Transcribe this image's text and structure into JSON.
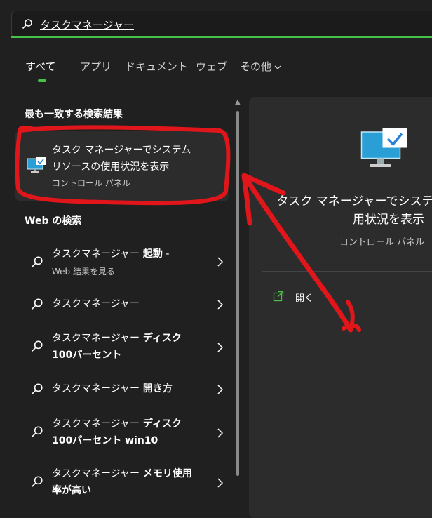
{
  "search": {
    "value": "タスクマネージャー"
  },
  "tabs": [
    {
      "label": "すべて",
      "active": true
    },
    {
      "label": "アプリ"
    },
    {
      "label": "ドキュメント"
    },
    {
      "label": "ウェブ"
    },
    {
      "label": "その他"
    }
  ],
  "best_match": {
    "section_title": "最も一致する検索結果",
    "title_line1": "タスク マネージャーでシステム",
    "title_line2": "リソースの使用状況を表示",
    "subtitle": "コントロール パネル"
  },
  "web": {
    "section_title": "Web の検索",
    "items": [
      {
        "text": "タスクマネージャー",
        "bold": " 起動",
        "suffix": " -",
        "sub": "Web 結果を見る"
      },
      {
        "text": "タスクマネージャー"
      },
      {
        "text": "タスクマネージャー",
        "bold": " ディスク",
        "line2": "100パーセント"
      },
      {
        "text": "タスクマネージャー",
        "bold": " 開き方"
      },
      {
        "text": "タスクマネージャー",
        "bold": " ディスク",
        "line2": "100パーセント win10"
      },
      {
        "text": "タスクマネージャー",
        "bold": " メモリ使用",
        "line2": "率が高い"
      }
    ]
  },
  "detail": {
    "title_line1": "タスク マネージャーでシステム",
    "title_line2": "用状況を表示",
    "subtitle": "コントロール パネル",
    "open_label": "開く"
  },
  "colors": {
    "accent": "#47c146",
    "annotation": "#e0161b",
    "background": "#202020",
    "panel": "#2c2c2c"
  }
}
